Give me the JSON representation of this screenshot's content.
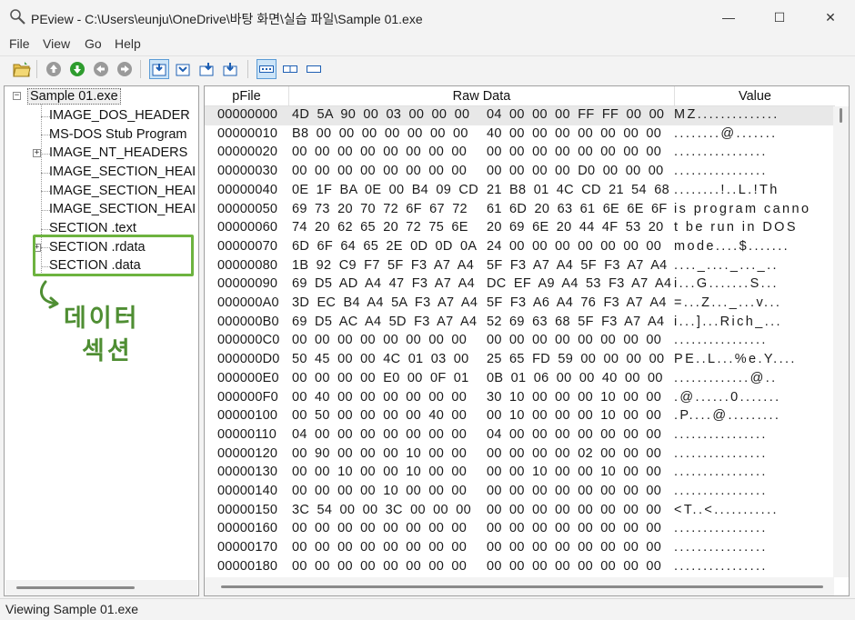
{
  "window": {
    "title": "PEview - C:\\Users\\eunju\\OneDrive\\바탕 화면\\실습 파일\\Sample 01.exe",
    "minimize_glyph": "—",
    "maximize_glyph": "☐",
    "close_glyph": "✕"
  },
  "menu": [
    "File",
    "View",
    "Go",
    "Help"
  ],
  "toolbar": {
    "icons": [
      "open-file-icon",
      "up-icon",
      "down-icon",
      "back-icon",
      "forward-icon",
      "view-1-icon",
      "view-2-icon",
      "view-3-icon",
      "view-4-icon",
      "byte-view-icon",
      "word-view-icon",
      "dword-view-icon"
    ]
  },
  "tree": {
    "root": "Sample 01.exe",
    "root_expander": "−",
    "collapsed_expander": "+",
    "items": [
      "IMAGE_DOS_HEADER",
      "MS-DOS Stub Program",
      "IMAGE_NT_HEADERS",
      "IMAGE_SECTION_HEAI",
      "IMAGE_SECTION_HEAI",
      "IMAGE_SECTION_HEAI",
      "SECTION .text",
      "SECTION .rdata",
      "SECTION .data"
    ],
    "annotation_text_line1": "데이터",
    "annotation_text_line2": "섹션",
    "annotation_color": "#6db33f"
  },
  "columns": {
    "pfile": "pFile",
    "raw": "Raw Data",
    "value": "Value"
  },
  "rows": [
    {
      "addr": "00000000",
      "raw_a": "4D 5A 90 00 03 00 00 00",
      "raw_b": "04 00 00 00 FF FF 00 00",
      "val": "MZ.............."
    },
    {
      "addr": "00000010",
      "raw_a": "B8 00 00 00 00 00 00 00",
      "raw_b": "40 00 00 00 00 00 00 00",
      "val": "........@......."
    },
    {
      "addr": "00000020",
      "raw_a": "00 00 00 00 00 00 00 00",
      "raw_b": "00 00 00 00 00 00 00 00",
      "val": "................"
    },
    {
      "addr": "00000030",
      "raw_a": "00 00 00 00 00 00 00 00",
      "raw_b": "00 00 00 00 D0 00 00 00",
      "val": "................"
    },
    {
      "addr": "00000040",
      "raw_a": "0E 1F BA 0E 00 B4 09 CD",
      "raw_b": "21 B8 01 4C CD 21 54 68",
      "val": "........!..L.!Th"
    },
    {
      "addr": "00000050",
      "raw_a": "69 73 20 70 72 6F 67 72",
      "raw_b": "61 6D 20 63 61 6E 6E 6F",
      "val": "is program canno"
    },
    {
      "addr": "00000060",
      "raw_a": "74 20 62 65 20 72 75 6E",
      "raw_b": "20 69 6E 20 44 4F 53 20",
      "val": "t be run in DOS "
    },
    {
      "addr": "00000070",
      "raw_a": "6D 6F 64 65 2E 0D 0D 0A",
      "raw_b": "24 00 00 00 00 00 00 00",
      "val": "mode....$......."
    },
    {
      "addr": "00000080",
      "raw_a": "1B 92 C9 F7 5F F3 A7 A4",
      "raw_b": "5F F3 A7 A4 5F F3 A7 A4",
      "val": "...._...._..._.."
    },
    {
      "addr": "00000090",
      "raw_a": "69 D5 AD A4 47 F3 A7 A4",
      "raw_b": "DC EF A9 A4 53 F3 A7 A4",
      "val": "i...G.......S..."
    },
    {
      "addr": "000000A0",
      "raw_a": "3D EC B4 A4 5A F3 A7 A4",
      "raw_b": "5F F3 A6 A4 76 F3 A7 A4",
      "val": "=...Z..._...v..."
    },
    {
      "addr": "000000B0",
      "raw_a": "69 D5 AC A4 5D F3 A7 A4",
      "raw_b": "52 69 63 68 5F F3 A7 A4",
      "val": "i...]...Rich_..."
    },
    {
      "addr": "000000C0",
      "raw_a": "00 00 00 00 00 00 00 00",
      "raw_b": "00 00 00 00 00 00 00 00",
      "val": "................"
    },
    {
      "addr": "000000D0",
      "raw_a": "50 45 00 00 4C 01 03 00",
      "raw_b": "25 65 FD 59 00 00 00 00",
      "val": "PE..L...%e.Y...."
    },
    {
      "addr": "000000E0",
      "raw_a": "00 00 00 00 E0 00 0F 01",
      "raw_b": "0B 01 06 00 00 40 00 00",
      "val": ".............@.."
    },
    {
      "addr": "000000F0",
      "raw_a": "00 40 00 00 00 00 00 00",
      "raw_b": "30 10 00 00 00 10 00 00",
      "val": ".@......0......."
    },
    {
      "addr": "00000100",
      "raw_a": "00 50 00 00 00 00 40 00",
      "raw_b": "00 10 00 00 00 10 00 00",
      "val": ".P....@........."
    },
    {
      "addr": "00000110",
      "raw_a": "04 00 00 00 00 00 00 00",
      "raw_b": "04 00 00 00 00 00 00 00",
      "val": "................"
    },
    {
      "addr": "00000120",
      "raw_a": "00 90 00 00 00 10 00 00",
      "raw_b": "00 00 00 00 02 00 00 00",
      "val": "................"
    },
    {
      "addr": "00000130",
      "raw_a": "00 00 10 00 00 10 00 00",
      "raw_b": "00 00 10 00 00 10 00 00",
      "val": "................"
    },
    {
      "addr": "00000140",
      "raw_a": "00 00 00 00 10 00 00 00",
      "raw_b": "00 00 00 00 00 00 00 00",
      "val": "................"
    },
    {
      "addr": "00000150",
      "raw_a": "3C 54 00 00 3C 00 00 00",
      "raw_b": "00 00 00 00 00 00 00 00",
      "val": "<T..<..........."
    },
    {
      "addr": "00000160",
      "raw_a": "00 00 00 00 00 00 00 00",
      "raw_b": "00 00 00 00 00 00 00 00",
      "val": "................"
    },
    {
      "addr": "00000170",
      "raw_a": "00 00 00 00 00 00 00 00",
      "raw_b": "00 00 00 00 00 00 00 00",
      "val": "................"
    },
    {
      "addr": "00000180",
      "raw_a": "00 00 00 00 00 00 00 00",
      "raw_b": "00 00 00 00 00 00 00 00",
      "val": "................"
    }
  ],
  "status": "Viewing Sample 01.exe"
}
